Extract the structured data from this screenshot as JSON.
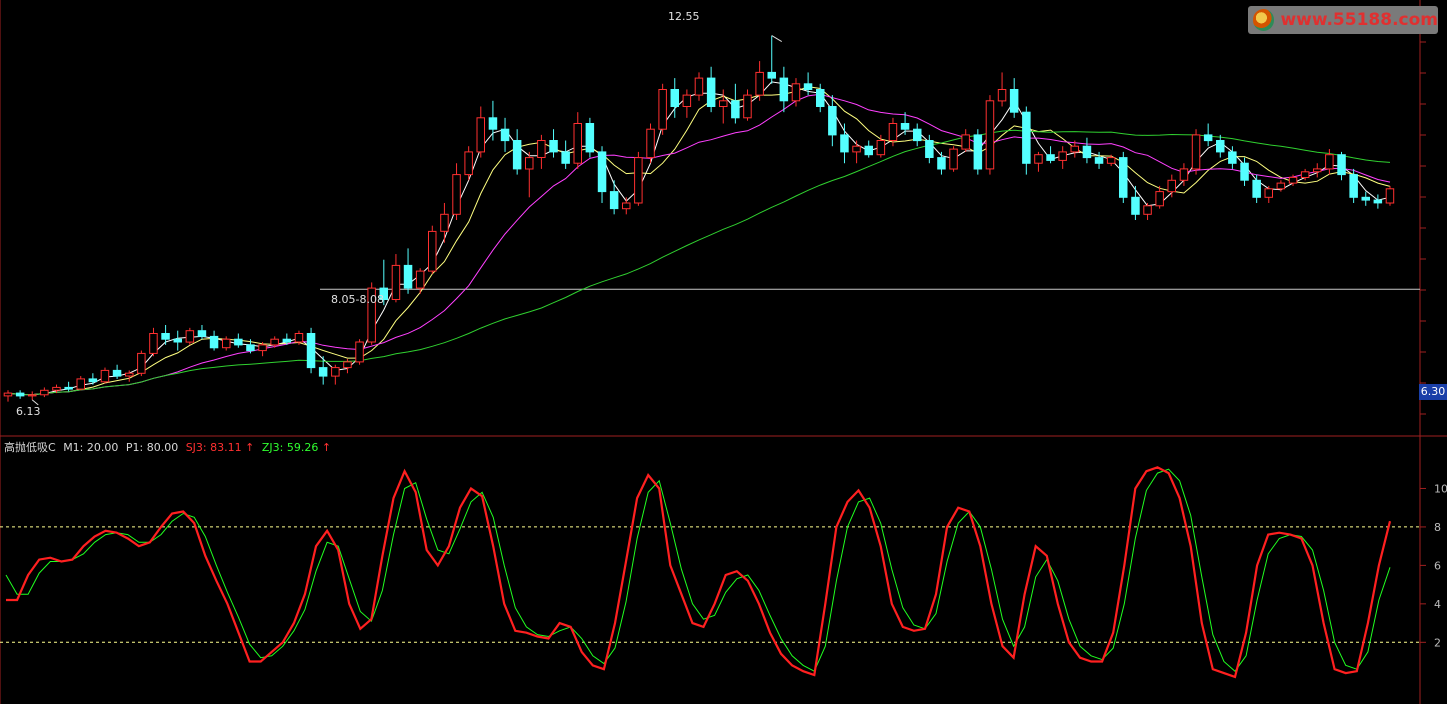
{
  "watermark": {
    "text": "www.55188.com"
  },
  "price_tag": "6.30",
  "indicator_header": {
    "name": "高抛低吸C",
    "m1": "M1: 20.00",
    "p1": "P1: 80.00",
    "sj3": "SJ3: 83.11",
    "sj3_arrow": "↑",
    "zj3": "ZJ3: 59.26",
    "zj3_arrow": "↑"
  },
  "price_annotations": {
    "high_label": "12.55",
    "low_label": "6.13",
    "range_label": "8.05-8.08"
  },
  "colors": {
    "up": "#ff3030",
    "down": "#54ffff",
    "ma_fast": "#ffffff",
    "ma_mid": "#ffff80",
    "ma_slow": "#ff40ff",
    "ma_long": "#30d030",
    "sj3": "#ff2020",
    "zj3": "#20ff20",
    "signal_s": "#30ff30",
    "signal_b": "#ff3030",
    "sell_text": "#ffb060",
    "buy_text": "#50ff50",
    "dashed": "#ffff90",
    "axis": "#a02020"
  },
  "chart_data": [
    {
      "type": "candlestick",
      "title": "",
      "ylim": [
        5.6,
        13.0
      ],
      "support_level": 8.08,
      "candles": [
        [
          6.2,
          6.3,
          6.1,
          6.25
        ],
        [
          6.25,
          6.3,
          6.15,
          6.2
        ],
        [
          6.2,
          6.28,
          6.13,
          6.22
        ],
        [
          6.22,
          6.35,
          6.18,
          6.3
        ],
        [
          6.3,
          6.4,
          6.25,
          6.35
        ],
        [
          6.35,
          6.45,
          6.28,
          6.32
        ],
        [
          6.32,
          6.55,
          6.3,
          6.5
        ],
        [
          6.5,
          6.6,
          6.4,
          6.45
        ],
        [
          6.45,
          6.7,
          6.42,
          6.65
        ],
        [
          6.65,
          6.75,
          6.5,
          6.55
        ],
        [
          6.55,
          6.65,
          6.45,
          6.6
        ],
        [
          6.6,
          7.0,
          6.55,
          6.95
        ],
        [
          6.95,
          7.4,
          6.9,
          7.3
        ],
        [
          7.3,
          7.45,
          7.1,
          7.2
        ],
        [
          7.2,
          7.35,
          7.0,
          7.15
        ],
        [
          7.15,
          7.4,
          7.1,
          7.35
        ],
        [
          7.35,
          7.45,
          7.2,
          7.25
        ],
        [
          7.25,
          7.35,
          7.0,
          7.05
        ],
        [
          7.05,
          7.25,
          7.0,
          7.2
        ],
        [
          7.2,
          7.3,
          7.05,
          7.1
        ],
        [
          7.1,
          7.2,
          6.95,
          7.0
        ],
        [
          7.0,
          7.15,
          6.9,
          7.1
        ],
        [
          7.1,
          7.25,
          7.05,
          7.2
        ],
        [
          7.2,
          7.3,
          7.1,
          7.15
        ],
        [
          7.15,
          7.35,
          7.1,
          7.3
        ],
        [
          7.3,
          7.4,
          6.6,
          6.7
        ],
        [
          6.7,
          6.9,
          6.4,
          6.55
        ],
        [
          6.55,
          6.75,
          6.4,
          6.7
        ],
        [
          6.7,
          6.85,
          6.6,
          6.8
        ],
        [
          6.8,
          7.2,
          6.75,
          7.15
        ],
        [
          7.15,
          8.2,
          7.1,
          8.1
        ],
        [
          8.1,
          8.6,
          7.8,
          7.9
        ],
        [
          7.9,
          8.7,
          7.85,
          8.5
        ],
        [
          8.5,
          8.8,
          8.0,
          8.1
        ],
        [
          8.1,
          8.45,
          8.0,
          8.4
        ],
        [
          8.4,
          9.2,
          8.35,
          9.1
        ],
        [
          9.1,
          9.6,
          8.9,
          9.4
        ],
        [
          9.4,
          10.3,
          9.3,
          10.1
        ],
        [
          10.1,
          10.6,
          10.0,
          10.5
        ],
        [
          10.5,
          11.3,
          10.4,
          11.1
        ],
        [
          11.1,
          11.4,
          10.7,
          10.9
        ],
        [
          10.9,
          11.1,
          10.5,
          10.7
        ],
        [
          10.7,
          10.9,
          10.1,
          10.2
        ],
        [
          10.2,
          10.5,
          9.7,
          10.4
        ],
        [
          10.4,
          10.8,
          10.2,
          10.7
        ],
        [
          10.7,
          10.9,
          10.4,
          10.5
        ],
        [
          10.5,
          10.7,
          10.2,
          10.3
        ],
        [
          10.3,
          11.2,
          10.2,
          11.0
        ],
        [
          11.0,
          11.1,
          10.4,
          10.5
        ],
        [
          10.5,
          10.6,
          9.6,
          9.8
        ],
        [
          9.8,
          10.0,
          9.4,
          9.5
        ],
        [
          9.5,
          9.7,
          9.4,
          9.6
        ],
        [
          9.6,
          10.5,
          9.55,
          10.4
        ],
        [
          10.4,
          11.0,
          10.3,
          10.9
        ],
        [
          10.9,
          11.7,
          10.8,
          11.6
        ],
        [
          11.6,
          11.8,
          11.1,
          11.3
        ],
        [
          11.3,
          11.6,
          11.1,
          11.5
        ],
        [
          11.5,
          11.9,
          11.4,
          11.8
        ],
        [
          11.8,
          12.0,
          11.2,
          11.3
        ],
        [
          11.3,
          11.6,
          11.0,
          11.4
        ],
        [
          11.4,
          11.7,
          11.0,
          11.1
        ],
        [
          11.1,
          11.6,
          11.05,
          11.5
        ],
        [
          11.5,
          12.1,
          11.4,
          11.9
        ],
        [
          11.9,
          12.55,
          11.7,
          11.8
        ],
        [
          11.8,
          12.0,
          11.2,
          11.4
        ],
        [
          11.4,
          11.8,
          11.3,
          11.7
        ],
        [
          11.7,
          11.9,
          11.5,
          11.6
        ],
        [
          11.6,
          11.7,
          11.2,
          11.3
        ],
        [
          11.3,
          11.5,
          10.6,
          10.8
        ],
        [
          10.8,
          11.0,
          10.3,
          10.5
        ],
        [
          10.5,
          10.7,
          10.3,
          10.6
        ],
        [
          10.6,
          10.7,
          10.4,
          10.45
        ],
        [
          10.45,
          10.8,
          10.4,
          10.7
        ],
        [
          10.7,
          11.1,
          10.6,
          11.0
        ],
        [
          11.0,
          11.2,
          10.8,
          10.9
        ],
        [
          10.9,
          11.0,
          10.6,
          10.7
        ],
        [
          10.7,
          10.8,
          10.3,
          10.4
        ],
        [
          10.4,
          10.5,
          10.1,
          10.2
        ],
        [
          10.2,
          10.6,
          10.15,
          10.55
        ],
        [
          10.55,
          10.9,
          10.5,
          10.8
        ],
        [
          10.8,
          10.9,
          10.1,
          10.2
        ],
        [
          10.2,
          11.5,
          10.1,
          11.4
        ],
        [
          11.4,
          11.9,
          11.3,
          11.6
        ],
        [
          11.6,
          11.8,
          11.1,
          11.2
        ],
        [
          11.2,
          11.3,
          10.1,
          10.3
        ],
        [
          10.3,
          10.5,
          10.15,
          10.45
        ],
        [
          10.45,
          10.6,
          10.3,
          10.35
        ],
        [
          10.35,
          10.6,
          10.2,
          10.5
        ],
        [
          10.5,
          10.7,
          10.4,
          10.6
        ],
        [
          10.6,
          10.75,
          10.3,
          10.4
        ],
        [
          10.4,
          10.5,
          10.2,
          10.3
        ],
        [
          10.3,
          10.45,
          10.25,
          10.4
        ],
        [
          10.4,
          10.5,
          9.6,
          9.7
        ],
        [
          9.7,
          9.9,
          9.3,
          9.4
        ],
        [
          9.4,
          9.6,
          9.3,
          9.55
        ],
        [
          9.55,
          9.9,
          9.5,
          9.8
        ],
        [
          9.8,
          10.1,
          9.7,
          10.0
        ],
        [
          10.0,
          10.3,
          9.9,
          10.2
        ],
        [
          10.2,
          10.9,
          10.1,
          10.8
        ],
        [
          10.8,
          11.0,
          10.6,
          10.7
        ],
        [
          10.7,
          10.8,
          10.4,
          10.5
        ],
        [
          10.5,
          10.6,
          10.2,
          10.3
        ],
        [
          10.3,
          10.4,
          9.9,
          10.0
        ],
        [
          10.0,
          10.1,
          9.6,
          9.7
        ],
        [
          9.7,
          9.9,
          9.6,
          9.85
        ],
        [
          9.85,
          10.0,
          9.8,
          9.95
        ],
        [
          9.95,
          10.1,
          9.9,
          10.05
        ],
        [
          10.05,
          10.2,
          10.0,
          10.15
        ],
        [
          10.15,
          10.3,
          10.05,
          10.2
        ],
        [
          10.2,
          10.55,
          10.1,
          10.45
        ],
        [
          10.45,
          10.5,
          10.0,
          10.1
        ],
        [
          10.1,
          10.2,
          9.6,
          9.7
        ],
        [
          9.7,
          9.8,
          9.55,
          9.65
        ],
        [
          9.65,
          9.75,
          9.5,
          9.6
        ],
        [
          9.6,
          9.9,
          9.55,
          9.85
        ]
      ]
    },
    {
      "type": "line",
      "title": "高抛低吸C",
      "ylim": [
        0,
        100
      ],
      "thresholds": [
        20,
        80
      ],
      "tick_labels": [
        10,
        8,
        6,
        4,
        2
      ],
      "series": [
        {
          "name": "SJ3",
          "values": [
            42,
            42,
            55,
            63,
            64,
            62,
            63,
            70,
            75,
            78,
            77,
            74,
            70,
            72,
            80,
            87,
            88,
            82,
            65,
            52,
            40,
            25,
            10,
            10,
            15,
            20,
            30,
            45,
            70,
            78,
            68,
            40,
            27,
            32,
            65,
            95,
            109,
            98,
            68,
            60,
            70,
            90,
            100,
            96,
            70,
            40,
            26,
            25,
            23,
            22,
            30,
            28,
            15,
            8,
            6,
            30,
            62,
            95,
            107,
            100,
            60,
            45,
            30,
            28,
            40,
            55,
            57,
            52,
            40,
            25,
            14,
            8,
            5,
            3,
            40,
            80,
            93,
            99,
            90,
            70,
            40,
            28,
            26,
            27,
            45,
            80,
            90,
            88,
            70,
            40,
            18,
            12,
            45,
            70,
            65,
            40,
            20,
            12,
            10,
            10,
            25,
            60,
            100,
            109,
            111,
            108,
            95,
            70,
            30,
            6,
            4,
            2,
            25,
            60,
            76,
            77,
            76,
            74,
            60,
            30,
            6,
            4,
            5,
            30,
            60,
            83
          ]
        },
        {
          "name": "ZJ3",
          "values": [
            55,
            45,
            45,
            56,
            62,
            62,
            63,
            66,
            72,
            76,
            77,
            76,
            72,
            72,
            76,
            83,
            87,
            85,
            75,
            60,
            46,
            33,
            19,
            12,
            13,
            18,
            26,
            37,
            57,
            72,
            70,
            53,
            36,
            31,
            47,
            76,
            100,
            103,
            84,
            68,
            66,
            79,
            93,
            98,
            85,
            60,
            38,
            28,
            24,
            23,
            26,
            28,
            22,
            13,
            9,
            17,
            41,
            74,
            98,
            104,
            82,
            58,
            40,
            32,
            34,
            46,
            53,
            55,
            47,
            34,
            22,
            13,
            8,
            5,
            18,
            52,
            80,
            93,
            95,
            82,
            58,
            38,
            29,
            27,
            35,
            62,
            82,
            88,
            80,
            58,
            32,
            18,
            28,
            54,
            63,
            52,
            32,
            18,
            13,
            11,
            17,
            40,
            74,
            99,
            108,
            110,
            104,
            86,
            54,
            24,
            10,
            5,
            13,
            42,
            66,
            74,
            76,
            75,
            68,
            47,
            20,
            8,
            6,
            15,
            42,
            59
          ]
        }
      ]
    }
  ]
}
